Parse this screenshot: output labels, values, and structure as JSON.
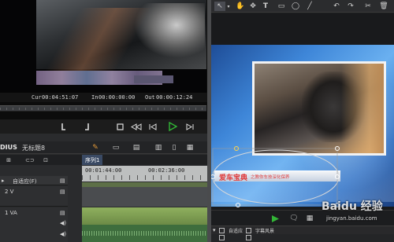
{
  "player": {
    "cur_label": "Cur",
    "cur_tc": "00:04:51:07",
    "in_label": "In",
    "in_tc": "00:00:00:00",
    "out_label": "Out",
    "out_tc": "00:00:12:24",
    "brand_fragment": "DIUS",
    "project_title": "无标题8"
  },
  "timeline": {
    "sequence_tab": "序列1",
    "ruler": [
      "00:01:44:00",
      "00:02:36:00"
    ],
    "tracks": [
      {
        "id": "track-adapt",
        "name": "自适应(F)"
      },
      {
        "id": "track-2v",
        "name": "2 V"
      },
      {
        "id": "track-1va",
        "name": "1 VA"
      }
    ]
  },
  "titler": {
    "tools": [
      "arrow-icon",
      "hand-icon",
      "move-icon",
      "text-icon",
      "rectangle-icon",
      "ellipse-icon",
      "line-icon",
      "undo-icon",
      "redo-icon",
      "cut-icon",
      "trash-icon"
    ],
    "subtitle_main": "爱车宝典",
    "subtitle_sub": "之教你车技深化保养",
    "layer_mode": "自适应",
    "layer_label": "字幕风景",
    "watermark_main": "Baidu 经验",
    "watermark_url": "jingyan.baidu.com"
  },
  "colors": {
    "accent_green": "#32b436",
    "subtitle_red": "#e03a3a",
    "highlight_orange": "#ff8a00"
  }
}
